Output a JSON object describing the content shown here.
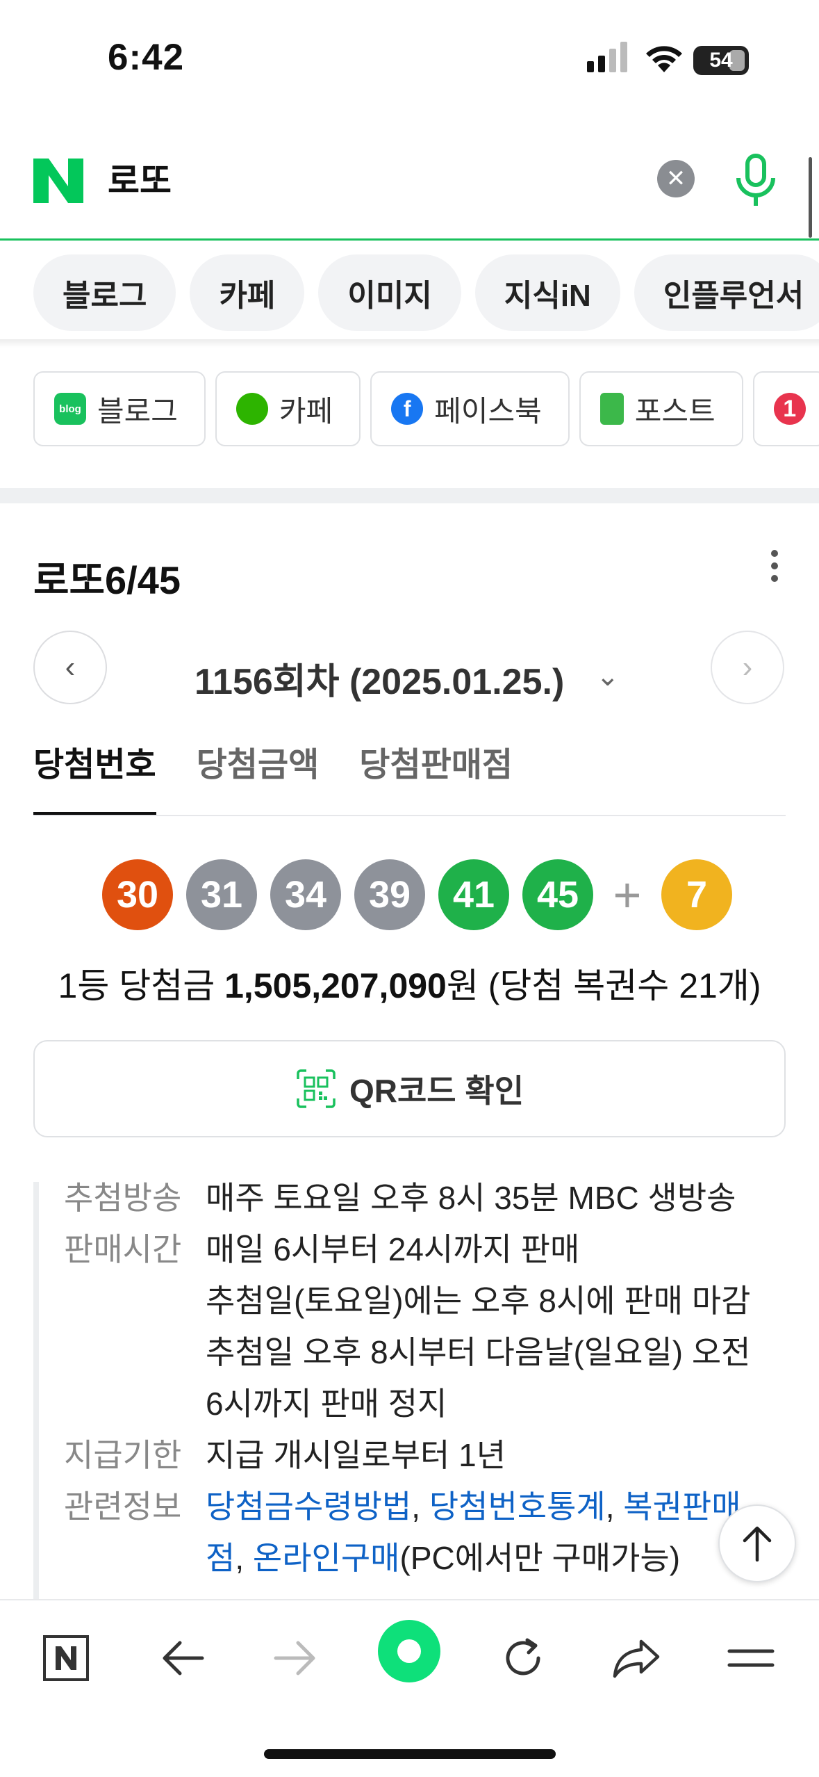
{
  "status": {
    "time": "6:42",
    "battery": "54"
  },
  "search": {
    "query": "로또",
    "logo": "N"
  },
  "categories": [
    "블로그",
    "카페",
    "이미지",
    "지식iN",
    "인플루언서"
  ],
  "sources": [
    {
      "label": "블로그",
      "icon": "blog-icon",
      "icon_text": "blog",
      "color": "#19c15d"
    },
    {
      "label": "카페",
      "icon": "cafe-icon",
      "icon_text": "",
      "color": "#2db400"
    },
    {
      "label": "페이스북",
      "icon": "facebook-icon",
      "icon_text": "f",
      "color": "#1877f2"
    },
    {
      "label": "포스트",
      "icon": "post-icon",
      "icon_text": "",
      "color": "#3cb84a"
    },
    {
      "label": "",
      "icon": "partial-icon",
      "icon_text": "1",
      "color": "#e8344e"
    }
  ],
  "card": {
    "title": "로또6/45",
    "round": "1156회차 (2025.01.25.)",
    "tabs": [
      "당첨번호",
      "당첨금액",
      "당첨판매점"
    ],
    "numbers": [
      {
        "n": "30",
        "color": "#e0500f"
      },
      {
        "n": "31",
        "color": "#8e929a"
      },
      {
        "n": "34",
        "color": "#8e929a"
      },
      {
        "n": "39",
        "color": "#8e929a"
      },
      {
        "n": "41",
        "color": "#1fb14a"
      },
      {
        "n": "45",
        "color": "#1fb14a"
      }
    ],
    "plus": "+",
    "bonus": {
      "n": "7",
      "color": "#f1b31f"
    },
    "prize_prefix": "1등 당첨금 ",
    "prize_amount": "1,505,207,090",
    "prize_suffix": "원 (당첨 복권수 21개)",
    "qr_label": "QR코드 확인"
  },
  "info": {
    "draw_key": "추첨방송",
    "draw_val": "매주 토요일 오후 8시 35분 MBC 생방송",
    "sale_key": "판매시간",
    "sale_lines": [
      "매일 6시부터 24시까지 판매",
      "추첨일(토요일)에는 오후 8시에 판매 마감",
      "추첨일 오후 8시부터 다음날(일요일) 오전",
      "6시까지 판매 정지"
    ],
    "pay_key": "지급기한",
    "pay_val": "지급 개시일로부터 1년",
    "rel_key": "관련정보",
    "rel_link1": "당첨금수령방법",
    "rel_link2": "당첨번호통계",
    "rel_link3a": "복권판매",
    "rel_link3b": "점",
    "rel_link4": "온라인구매",
    "rel_tail": "(PC에서만 구매가능)",
    "comma": ", "
  }
}
